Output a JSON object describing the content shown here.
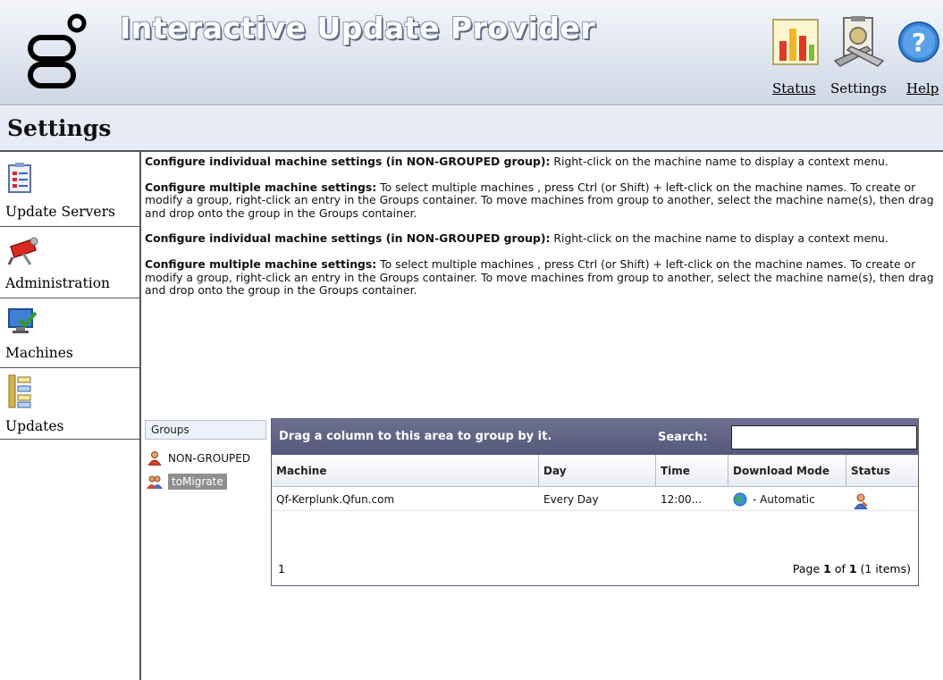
{
  "header": {
    "app_title": "Interactive Update Provider",
    "links": {
      "status": "Status",
      "settings": "Settings",
      "help": "Help"
    }
  },
  "page_title": "Settings",
  "sidebar": {
    "items": [
      {
        "label": "Update Servers",
        "icon": "checklist-icon"
      },
      {
        "label": "Administration",
        "icon": "toolbox-icon"
      },
      {
        "label": "Machines",
        "icon": "computer-check-icon"
      },
      {
        "label": "Updates",
        "icon": "tree-hierarchy-icon"
      }
    ]
  },
  "instructions": [
    {
      "heading": "Configure individual machine settings (in NON-GROUPED group):",
      "text": " Right-click on the machine name to display a context menu."
    },
    {
      "heading": "Configure multiple machine settings:",
      "text": " To select multiple machines , press Ctrl (or Shift) + left-click on the machine names. To create or modify a group, right-click an entry in the Groups container. To move machines from group to another, select the machine name(s), then drag and drop onto the group in the Groups container."
    },
    {
      "heading": "Configure individual machine settings (in NON-GROUPED group):",
      "text": " Right-click on the machine name to display a context menu."
    },
    {
      "heading": "Configure multiple machine settings:",
      "text": " To select multiple machines , press Ctrl (or Shift) + left-click on the machine names. To create or modify a group, right-click an entry in the Groups container. To move machines from group to another, select the machine name(s), then drag and drop onto the group in the Groups container."
    }
  ],
  "groups": {
    "header": "Groups",
    "items": [
      {
        "label": "NON-GROUPED",
        "selected": false
      },
      {
        "label": "toMigrate",
        "selected": true
      }
    ]
  },
  "grid": {
    "drag_hint": "Drag a column to this area to group by it.",
    "search_label": "Search:",
    "search_value": "",
    "columns": [
      "Machine",
      "Day",
      "Time",
      "Download Mode",
      "Status"
    ],
    "rows": [
      {
        "machine": "Qf-Kerplunk.Qfun.com",
        "day": "Every Day",
        "time": "12:00...",
        "download_mode": "- Automatic",
        "status_icon": "user-icon"
      }
    ],
    "footer_page_number": "1",
    "footer_pager": {
      "prefix": "Page ",
      "page": "1",
      "of": " of ",
      "total": "1",
      "suffix": " (1 items)"
    }
  },
  "colors": {
    "header_bg": "#dfe5ef",
    "titlebar_bg": "#e7ebf6",
    "grid_header_bg": "#5f6282",
    "selected_group_bg": "#8f8f8f"
  }
}
